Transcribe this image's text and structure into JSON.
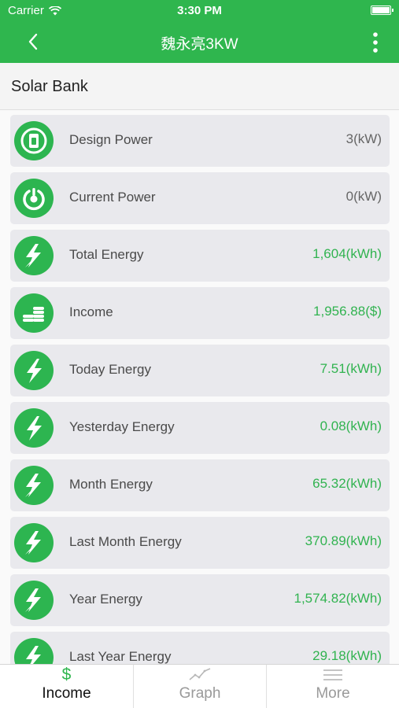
{
  "status_bar": {
    "carrier": "Carrier",
    "time": "3:30 PM"
  },
  "nav": {
    "title": "魏永亮3KW",
    "back_icon": "chevron-left-icon",
    "more_icon": "more-vertical-icon"
  },
  "section": {
    "title": "Solar Bank"
  },
  "rows": [
    {
      "label": "Design Power",
      "value": "3(kW)",
      "icon": "plug-icon"
    },
    {
      "label": "Current Power",
      "value": "0(kW)",
      "icon": "power-icon"
    },
    {
      "label": "Total Energy",
      "value": "1,604(kWh)",
      "icon": "double-bolt-icon"
    },
    {
      "label": "Income",
      "value": "1,956.88($)",
      "icon": "coins-icon"
    },
    {
      "label": "Today Energy",
      "value": "7.51(kWh)",
      "icon": "bolt-icon"
    },
    {
      "label": "Yesterday Energy",
      "value": "0.08(kWh)",
      "icon": "bolt-icon"
    },
    {
      "label": "Month Energy",
      "value": "65.32(kWh)",
      "icon": "double-bolt-icon"
    },
    {
      "label": "Last Month Energy",
      "value": "370.89(kWh)",
      "icon": "double-bolt-icon"
    },
    {
      "label": "Year Energy",
      "value": "1,574.82(kWh)",
      "icon": "double-bolt-icon"
    },
    {
      "label": "Last Year Energy",
      "value": "29.18(kWh)",
      "icon": "double-bolt-icon"
    }
  ],
  "tabs": [
    {
      "label": "Income",
      "icon": "dollar-icon",
      "active": true
    },
    {
      "label": "Graph",
      "icon": "line-chart-icon",
      "active": false
    },
    {
      "label": "More",
      "icon": "menu-icon",
      "active": false
    }
  ],
  "colors": {
    "brand_green": "#2fb64e",
    "value_green": "#31b350",
    "row_bg": "#e9e9ed"
  }
}
